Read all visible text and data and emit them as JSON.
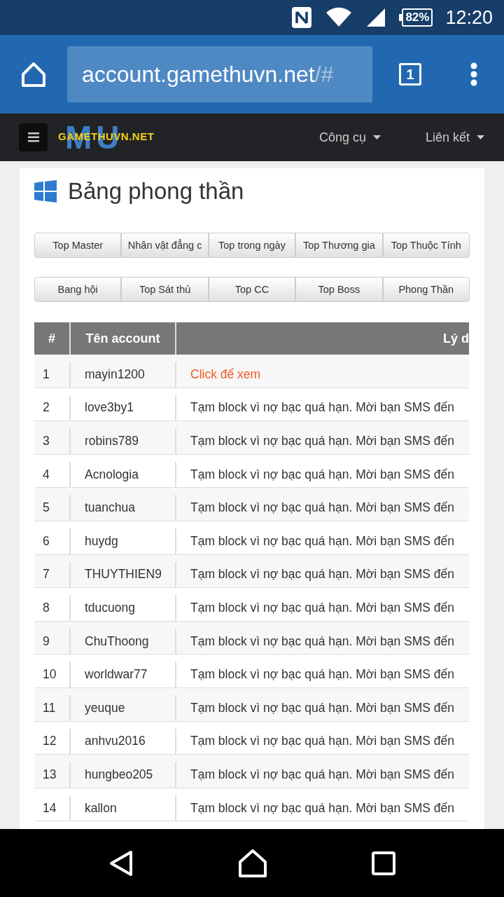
{
  "status_bar": {
    "battery": "82%",
    "time": "12:20"
  },
  "browser": {
    "url_main": "account.gamethuvn.net",
    "url_rest": "/#",
    "tab_count": "1"
  },
  "navbar": {
    "logo_back": "MU",
    "logo_text": "GAMETHUVN.NET",
    "menus": [
      "Công cụ",
      "Liên kết"
    ]
  },
  "page_title": "Bảng phong thần",
  "button_rows": [
    [
      "Top Master",
      "Nhân vật đẳng c",
      "Top trong ngày",
      "Top Thương gia",
      "Top Thuộc Tính"
    ],
    [
      "Bang hội",
      "Top Sát thủ",
      "Top CC",
      "Top Boss",
      "Phong Thần"
    ]
  ],
  "table": {
    "columns": [
      "#",
      "Tên account",
      "Lý d"
    ],
    "rows": [
      {
        "no": "1",
        "account": "mayin1200",
        "reason": "Click để xem",
        "kind": "link"
      },
      {
        "no": "2",
        "account": "love3by1",
        "reason": "Tạm block vì nợ bạc quá hạn. Mời bạn SMS đến",
        "kind": "text"
      },
      {
        "no": "3",
        "account": "robins789",
        "reason": "Tạm block vì nợ bạc quá hạn. Mời bạn SMS đến",
        "kind": "text"
      },
      {
        "no": "4",
        "account": "Acnologia",
        "reason": "Tạm block vì nợ bạc quá hạn. Mời bạn SMS đến",
        "kind": "text"
      },
      {
        "no": "5",
        "account": "tuanchua",
        "reason": "Tạm block vì nợ bạc quá hạn. Mời bạn SMS đến",
        "kind": "text"
      },
      {
        "no": "6",
        "account": "huydg",
        "reason": "Tạm block vì nợ bạc quá hạn. Mời bạn SMS đến",
        "kind": "text"
      },
      {
        "no": "7",
        "account": "THUYTHIEN9",
        "reason": "Tạm block vì nợ bạc quá hạn. Mời bạn SMS đến",
        "kind": "text"
      },
      {
        "no": "8",
        "account": "tducuong",
        "reason": "Tạm block vì nợ bạc quá hạn. Mời bạn SMS đến",
        "kind": "text"
      },
      {
        "no": "9",
        "account": "ChuThoong",
        "reason": "Tạm block vì nợ bạc quá hạn. Mời bạn SMS đến",
        "kind": "text"
      },
      {
        "no": "10",
        "account": "worldwar77",
        "reason": "Tạm block vì nợ bạc quá hạn. Mời bạn SMS đến",
        "kind": "text"
      },
      {
        "no": "11",
        "account": "yeuque",
        "reason": "Tạm block vì nợ bạc quá hạn. Mời bạn SMS đến",
        "kind": "text"
      },
      {
        "no": "12",
        "account": "anhvu2016",
        "reason": "Tạm block vì nợ bạc quá hạn. Mời bạn SMS đến",
        "kind": "text"
      },
      {
        "no": "13",
        "account": "hungbeo205",
        "reason": "Tạm block vì nợ bạc quá hạn. Mời bạn SMS đến",
        "kind": "text"
      },
      {
        "no": "14",
        "account": "kallon",
        "reason": "Tạm block vì nợ bạc quá hạn. Mời bạn SMS đến",
        "kind": "text"
      }
    ]
  }
}
